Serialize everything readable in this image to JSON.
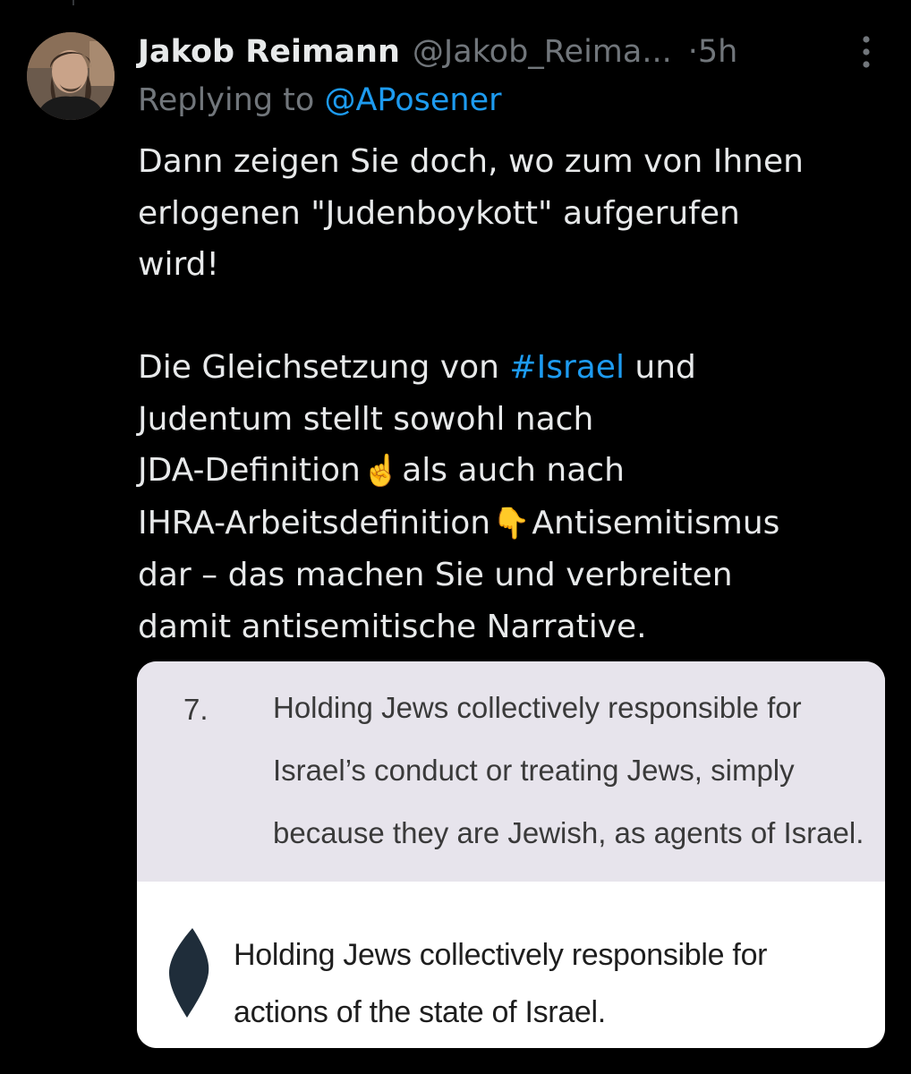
{
  "tweet": {
    "author_name": "Jakob Reimann",
    "author_handle": "@Jakob_Reima...",
    "separator": "·",
    "timestamp": "5h",
    "reply_prefix": "Replying to ",
    "reply_handle": "@APosener",
    "body": {
      "p1_lines": [
        "Dann zeigen Sie doch, wo zum von Ihnen",
        "erlogenen \"Judenboykott\" aufgerufen",
        "wird!"
      ],
      "p2_line1_pre": "Die Gleichsetzung von ",
      "p2_hashtag": "#Israel",
      "p2_line1_post": " und",
      "p2_line2": "Judentum stellt sowohl nach",
      "p2_line3_pre": "JDA-Definition",
      "emoji_point_up": "☝️",
      "p2_line3_post": "als auch nach",
      "p2_line4_pre": "IHRA-Arbeitsdefinition",
      "emoji_point_down": "👇",
      "p2_line4_post": "Antisemitismus",
      "p2_line5": "dar – das machen Sie und verbreiten",
      "p2_line6": "damit antisemitische Narrative."
    },
    "more_icon": "more-vertical-icon",
    "avatar_icon": "profile-photo"
  },
  "media": {
    "ihra": {
      "number": "7.",
      "lines": [
        "Holding Jews collectively responsible for",
        "Israel’s conduct or treating Jews, simply",
        "because they are Jewish, as agents of Israel."
      ]
    },
    "jda": {
      "bullet_icon": "diamond-bullet-icon",
      "lines": [
        "Holding Jews collectively responsible for",
        "actions of the state of Israel."
      ]
    }
  },
  "colors": {
    "background": "#000000",
    "primary_text": "#e7e9ea",
    "secondary_text": "#71767b",
    "link": "#1d9bf0",
    "ihra_bg": "#e7e4ec",
    "jda_bullet": "#1f2d3a"
  }
}
